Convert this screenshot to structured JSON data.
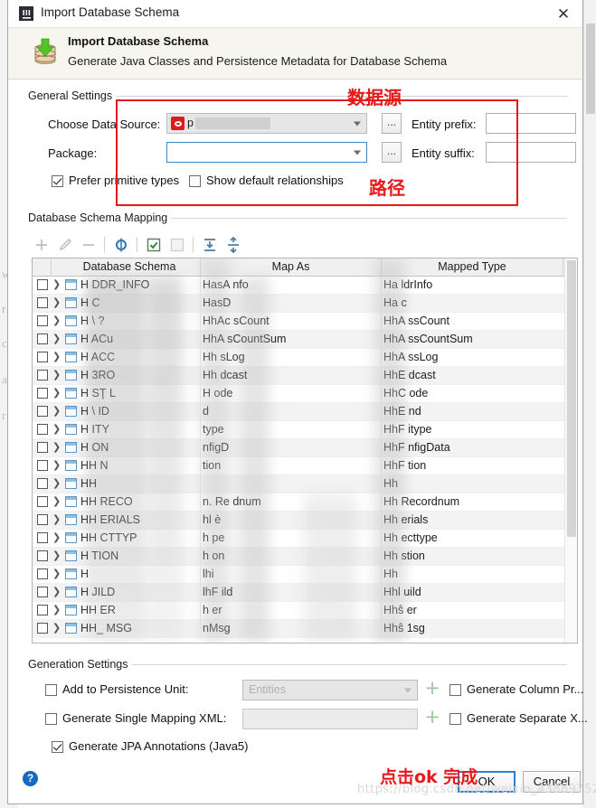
{
  "window": {
    "title": "Import Database Schema",
    "app_icon": "intellij-idea-icon",
    "close_label": "✕"
  },
  "banner": {
    "heading": "Import Database Schema",
    "subheading": "Generate Java Classes and Persistence Metadata for Database Schema",
    "icon": "database-import-icon"
  },
  "general_settings": {
    "group_label": "General Settings",
    "data_source_label": "Choose Data Source:",
    "data_source_value": "p",
    "data_source_icon": "oracle-datasource-icon",
    "package_label": "Package:",
    "package_value": "",
    "browse_label": "...",
    "entity_prefix_label": "Entity prefix:",
    "entity_prefix_value": "",
    "entity_suffix_label": "Entity suffix:",
    "entity_suffix_value": "",
    "prefer_primitive_label": "Prefer primitive types",
    "prefer_primitive_checked": true,
    "show_default_rel_label": "Show default relationships",
    "show_default_rel_checked": false
  },
  "schema_mapping": {
    "group_label": "Database Schema Mapping",
    "toolbar": [
      {
        "name": "add-icon",
        "glyph": "+",
        "enabled": false
      },
      {
        "name": "edit-pencil-icon",
        "glyph": "✎",
        "enabled": false
      },
      {
        "name": "remove-icon",
        "glyph": "−",
        "enabled": false
      },
      {
        "name": "refresh-icon",
        "glyph": "↺",
        "enabled": true
      },
      {
        "name": "select-all-icon",
        "glyph": "☑",
        "enabled": true
      },
      {
        "name": "deselect-all-icon",
        "glyph": "☐",
        "enabled": false
      },
      {
        "name": "expand-all-icon",
        "glyph": "↧",
        "enabled": true
      },
      {
        "name": "collapse-all-icon",
        "glyph": "↥",
        "enabled": true
      }
    ],
    "columns": [
      "Database Schema",
      "Map As",
      "Mapped Type"
    ],
    "rows": [
      {
        "schema": "H      DDR_INFO",
        "map_as": "HasA       nfo",
        "mapped": "Ha      ldrInfo"
      },
      {
        "schema": "H            C",
        "map_as": "HasD",
        "mapped": "Ha      c"
      },
      {
        "schema": "H     \\   ?",
        "map_as": "HhAc     sCount",
        "mapped": "HhA     ssCount"
      },
      {
        "schema": "H     ACu",
        "map_as": "HhA      sCountSum",
        "mapped": "HhA     ssCountSum"
      },
      {
        "schema": "H     ACC",
        "map_as": "Hh       sLog",
        "mapped": "HhA     ssLog"
      },
      {
        "schema": "H     3RO",
        "map_as": "Hh       dcast",
        "mapped": "HhE     dcast"
      },
      {
        "schema": "H     SŢ  L",
        "map_as": "H        ode",
        "mapped": "HhC     ode"
      },
      {
        "schema": "H     \\   ID",
        "map_as": "         d",
        "mapped": "HhE     nd"
      },
      {
        "schema": "H        ITY",
        "map_as": "         type",
        "mapped": "HhF     itype"
      },
      {
        "schema": "H        ON",
        "map_as": "      nfigD",
        "mapped": "HhF     nfigData"
      },
      {
        "schema": "HH          N",
        "map_as": "         tion",
        "mapped": "HhF     tion"
      },
      {
        "schema": "HH",
        "map_as": "",
        "mapped": "Hh"
      },
      {
        "schema": "HH    RECO",
        "map_as": "n.  Re    dnum",
        "mapped": "Hh     Recordnum"
      },
      {
        "schema": "HH    ERIALS",
        "map_as": "hl    è",
        "mapped": "Hh     erials"
      },
      {
        "schema": "HH    CTTYP",
        "map_as": "h        pe",
        "mapped": "Hh     ecttype"
      },
      {
        "schema": "H     TION",
        "map_as": "h      on",
        "mapped": "Hh     stion"
      },
      {
        "schema": "H",
        "map_as": "lhi",
        "mapped": "Hh"
      },
      {
        "schema": "H     JILD",
        "map_as": "lhF   ild",
        "mapped": "Hhl    uild"
      },
      {
        "schema": "HH    ER",
        "map_as": "h     er",
        "mapped": "Hhŝ   er"
      },
      {
        "schema": "HH_   MSG",
        "map_as": "     nMsg",
        "mapped": "Hhŝ   1sg"
      }
    ]
  },
  "generation_settings": {
    "group_label": "Generation Settings",
    "add_to_persistence_label": "Add to Persistence Unit:",
    "add_to_persistence_checked": false,
    "persistence_unit_placeholder": "Entities",
    "persistence_unit_value": "",
    "single_mapping_label": "Generate Single Mapping XML:",
    "single_mapping_checked": false,
    "single_mapping_value": "",
    "generate_column_label": "Generate Column Pr...",
    "generate_column_checked": false,
    "generate_separate_label": "Generate Separate X...",
    "generate_separate_checked": false,
    "jpa_annotations_label": "Generate JPA Annotations (Java5)",
    "jpa_annotations_checked": true,
    "add_button_label": "+"
  },
  "footer": {
    "help_label": "?",
    "ok_label": "OK",
    "cancel_label": "Cancel",
    "watermark": "https://blog.csdn.net/weixin_43889752"
  },
  "annotations": {
    "data_source": "数据源",
    "path": "路径",
    "click_ok": "点击ok 完成",
    "color": "#e8191a"
  }
}
